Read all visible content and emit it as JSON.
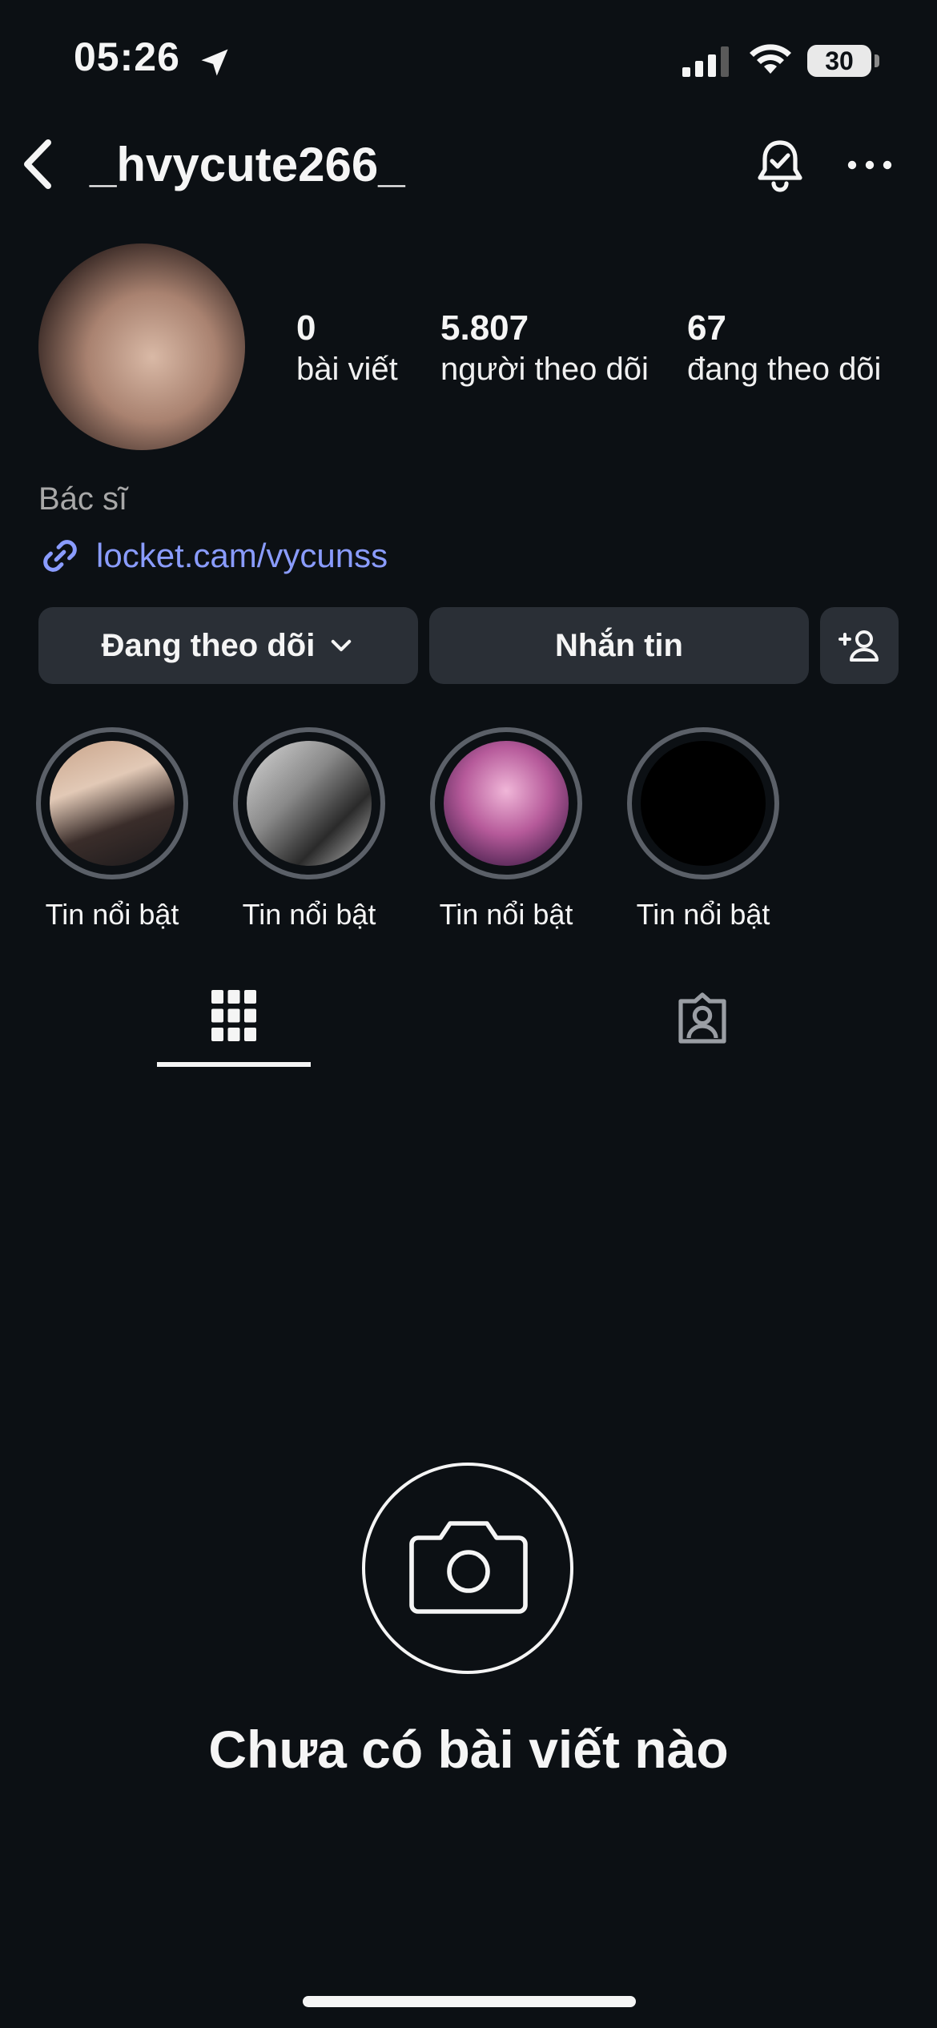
{
  "status_bar": {
    "time": "05:26",
    "battery": "30"
  },
  "header": {
    "username": "_hvycute266_"
  },
  "profile": {
    "stats": [
      {
        "number": "0",
        "label": "bài viết"
      },
      {
        "number": "5.807",
        "label": "người theo dõi"
      },
      {
        "number": "67",
        "label": "đang theo dõi"
      }
    ],
    "bio": "Bác sĩ",
    "link": "locket.cam/vycunss"
  },
  "actions": {
    "following_label": "Đang theo dõi",
    "message_label": "Nhắn tin"
  },
  "highlights": [
    {
      "label": "Tin nổi bật"
    },
    {
      "label": "Tin nổi bật"
    },
    {
      "label": "Tin nổi bật"
    },
    {
      "label": "Tin nổi bật"
    }
  ],
  "empty_state": {
    "text": "Chưa có bài viết nào"
  },
  "colors": {
    "background": "#0c1014",
    "button": "#2a2f36",
    "link": "#8a9cff",
    "muted_text": "#a8a8a8"
  }
}
